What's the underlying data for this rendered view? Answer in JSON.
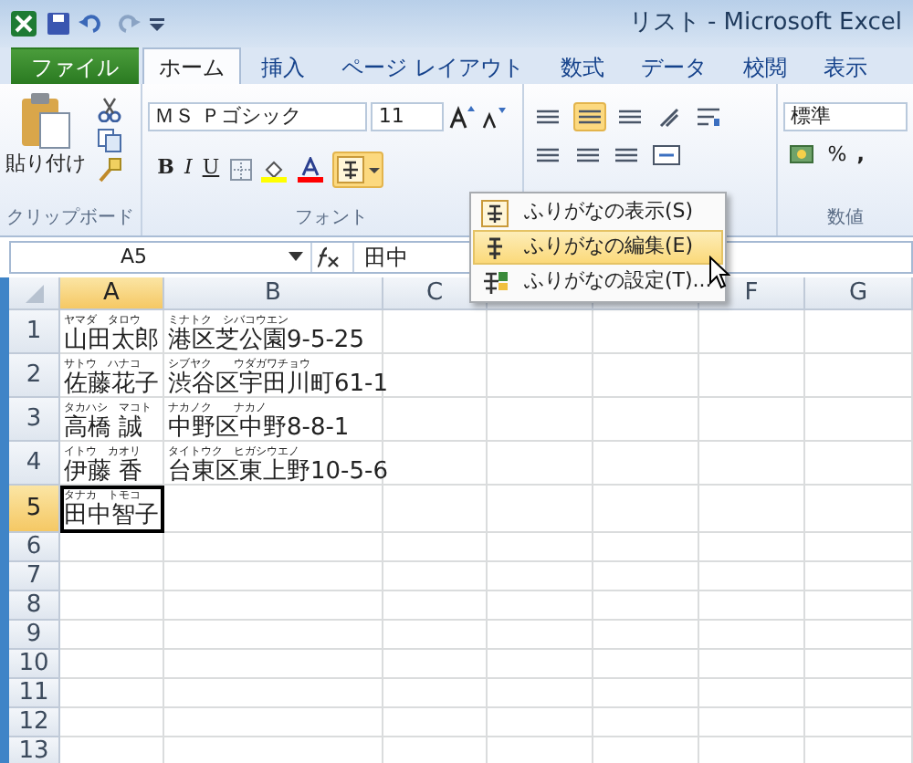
{
  "window": {
    "title": "リスト - Microsoft Excel"
  },
  "tabs": [
    {
      "label": "ファイル",
      "kind": "file",
      "selected": false
    },
    {
      "label": "ホーム",
      "kind": "tab",
      "selected": true
    },
    {
      "label": "挿入",
      "kind": "tab",
      "selected": false
    },
    {
      "label": "ページ レイアウト",
      "kind": "tab",
      "selected": false
    },
    {
      "label": "数式",
      "kind": "tab",
      "selected": false
    },
    {
      "label": "データ",
      "kind": "tab",
      "selected": false
    },
    {
      "label": "校閲",
      "kind": "tab",
      "selected": false
    },
    {
      "label": "表示",
      "kind": "tab",
      "selected": false
    }
  ],
  "ribbon": {
    "clipboard": {
      "paste_label": "貼り付け",
      "group_label": "クリップボード"
    },
    "font": {
      "name": "ＭＳ Ｐゴシック",
      "size": "11",
      "bold": "B",
      "italic": "I",
      "underline": "U",
      "group_label": "フォント"
    },
    "number": {
      "format": "標準",
      "percent": "%",
      "comma": ",",
      "group_label": "数値"
    }
  },
  "formula_bar": {
    "name_box": "A5",
    "value": "田中"
  },
  "phonetic_menu": [
    {
      "label": "ふりがなの表示(S)",
      "selected": false
    },
    {
      "label": "ふりがなの編集(E)",
      "selected": true
    },
    {
      "label": "ふりがなの設定(T)...",
      "selected": false
    }
  ],
  "sheet": {
    "columns": [
      {
        "label": "A",
        "selected": true
      },
      {
        "label": "B",
        "selected": false
      },
      {
        "label": "C",
        "selected": false
      },
      {
        "selected": false
      },
      {
        "selected": false
      },
      {
        "label": "F",
        "selected": false
      },
      {
        "label": "G",
        "selected": false
      }
    ],
    "rows": [
      {
        "label": "1",
        "selected": false,
        "cells": [
          {
            "furigana": "ヤマダ　タロウ",
            "text": "山田太郎",
            "selected": false
          },
          {
            "furigana": "ミナトク　シバコウエン",
            "text": "港区芝公園9-5-25",
            "selected": false
          }
        ]
      },
      {
        "label": "2",
        "selected": false,
        "cells": [
          {
            "furigana": "サトウ　ハナコ",
            "text": "佐藤花子",
            "selected": false
          },
          {
            "furigana": "シブヤク　　ウダガワチョウ",
            "text": "渋谷区宇田川町61-1",
            "selected": false
          }
        ]
      },
      {
        "label": "3",
        "selected": false,
        "cells": [
          {
            "furigana": "タカハシ　マコト",
            "text": "高橋 誠",
            "selected": false
          },
          {
            "furigana": "ナカノク　　ナカノ",
            "text": "中野区中野8-8-1",
            "selected": false
          }
        ]
      },
      {
        "label": "4",
        "selected": false,
        "cells": [
          {
            "furigana": "イトウ　カオリ",
            "text": "伊藤 香",
            "selected": false
          },
          {
            "furigana": "タイトウク　ヒガシウエノ",
            "text": "台東区東上野10-5-6",
            "selected": false
          }
        ]
      },
      {
        "label": "5",
        "selected": true,
        "cells": [
          {
            "furigana": "タナカ　トモコ",
            "text": "田中智子",
            "selected": true
          }
        ]
      },
      {
        "label": "6",
        "selected": false
      },
      {
        "label": "7",
        "selected": false
      },
      {
        "label": "8",
        "selected": false
      },
      {
        "label": "9",
        "selected": false
      },
      {
        "label": "10",
        "selected": false
      },
      {
        "label": "11",
        "selected": false
      },
      {
        "label": "12",
        "selected": false
      },
      {
        "label": "13",
        "selected": false
      }
    ]
  }
}
